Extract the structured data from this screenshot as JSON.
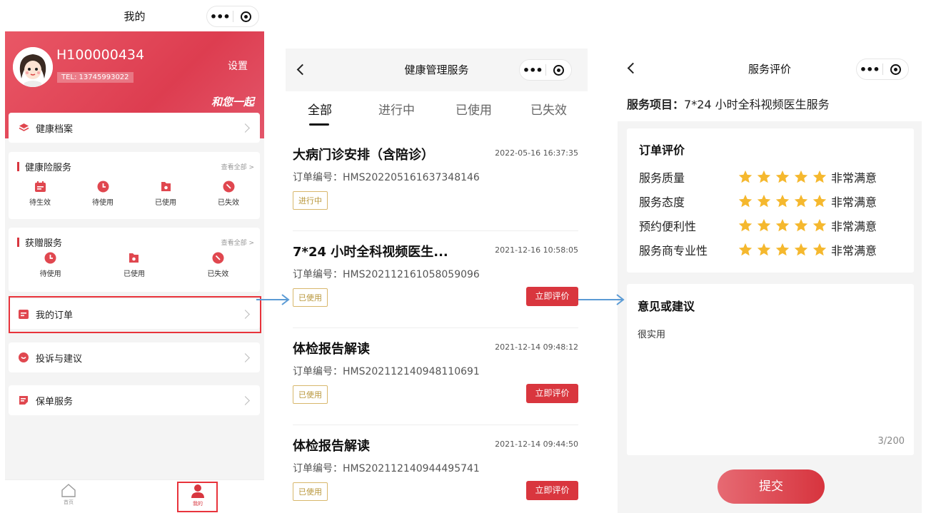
{
  "screen1": {
    "title": "我的",
    "user": {
      "name": "H100000434",
      "tel": "TEL: 13745993022"
    },
    "settings_label": "设置",
    "slogan": "和您一起",
    "health_record": "健康档案",
    "insurance": {
      "title": "健康险服务",
      "more": "查看全部 >",
      "items": [
        "待生效",
        "待使用",
        "已使用",
        "已失效"
      ]
    },
    "gift": {
      "title": "获赠服务",
      "more": "查看全部 >",
      "items": [
        "待使用",
        "已使用",
        "已失效"
      ]
    },
    "my_orders": "我的订单",
    "complaints": "投诉与建议",
    "policy": "保单服务",
    "tabbar": {
      "home": "首页",
      "mine": "我的"
    },
    "colors": {
      "accent": "#d8363f",
      "hero": "#e04a5b"
    }
  },
  "screen2": {
    "title": "健康管理服务",
    "tabs": [
      "全部",
      "进行中",
      "已使用",
      "已失效"
    ],
    "orders": [
      {
        "name": "大病门诊安排（含陪诊）",
        "date": "2022-05-16 16:37:35",
        "no": "订单编号：HMS202205161637348146",
        "status": "进行中",
        "action": ""
      },
      {
        "name": "7*24 小时全科视频医生...",
        "date": "2021-12-16 10:58:05",
        "no": "订单编号：HMS202112161058059096",
        "status": "已使用",
        "action": "立即评价"
      },
      {
        "name": "体检报告解读",
        "date": "2021-12-14 09:48:12",
        "no": "订单编号：HMS202112140948110691",
        "status": "已使用",
        "action": "立即评价"
      },
      {
        "name": "体检报告解读",
        "date": "2021-12-14 09:44:50",
        "no": "订单编号：HMS202112140944495741",
        "status": "已使用",
        "action": "立即评价"
      }
    ]
  },
  "screen3": {
    "title": "服务评价",
    "service_label": "服务项目：",
    "service_name": "7*24 小时全科视频医生服务",
    "rating_title": "订单评价",
    "ratings": [
      {
        "label": "服务质量",
        "stars": 5,
        "value": "非常满意"
      },
      {
        "label": "服务态度",
        "stars": 5,
        "value": "非常满意"
      },
      {
        "label": "预约便利性",
        "stars": 5,
        "value": "非常满意"
      },
      {
        "label": "服务商专业性",
        "stars": 5,
        "value": "非常满意"
      }
    ],
    "suggestion_title": "意见或建议",
    "suggestion_text": "很实用",
    "counter": "3/200",
    "submit": "提交",
    "star_color": "#f5b82e"
  }
}
